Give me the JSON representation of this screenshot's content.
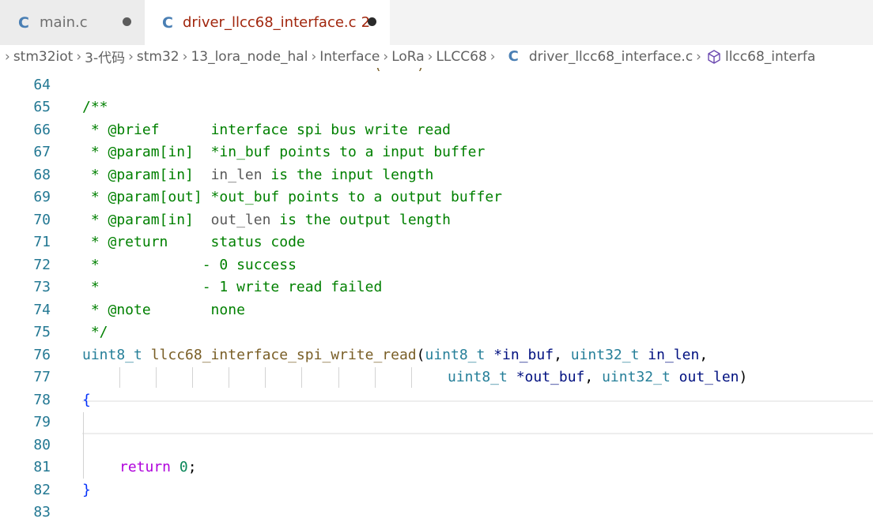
{
  "tabs": [
    {
      "icon": "C",
      "label": "main.c",
      "count": "",
      "modified": true,
      "active": false
    },
    {
      "icon": "C",
      "label": "driver_llcc68_interface.c",
      "count": "2",
      "modified": true,
      "active": true
    }
  ],
  "breadcrumb": {
    "items": [
      "stm32iot",
      "3-代码",
      "stm32",
      "13_lora_node_hal",
      "Interface",
      "LoRa",
      "LLCC68"
    ],
    "file_icon": "C",
    "file": "driver_llcc68_interface.c",
    "symbol_icon": "cube-icon",
    "symbol": "llcc68_interfa"
  },
  "editor": {
    "line_numbers": [
      "64",
      "65",
      "66",
      "67",
      "68",
      "69",
      "70",
      "71",
      "72",
      "73",
      "74",
      "75",
      "76",
      "77",
      "78",
      "79",
      "80",
      "81",
      "82",
      "83"
    ],
    "lines": {
      "l65": "/**",
      "l66_tag": " * @brief",
      "l66_text": "      interface spi bus write read",
      "l67_tag": " * @param[in]",
      "l67_text": "  *in_buf points to a input buffer",
      "l68_tag": " * @param[in]",
      "l68_param": "  in_len",
      "l68_text": " is the input length",
      "l69_tag": " * @param[out]",
      "l69_text": " *out_buf points to a output buffer",
      "l70_tag": " * @param[in]",
      "l70_param": "  out_len",
      "l70_text": " is the output length",
      "l71_tag": " * @return",
      "l71_text": "     status code",
      "l72_text": " *            - 0 success",
      "l73_text": " *            - 1 write read failed",
      "l74_tag": " * @note",
      "l74_text": "       none",
      "l75": " */",
      "l76_type1": "uint8_t",
      "l76_fn": "llcc68_interface_spi_write_read",
      "l76_open": "(",
      "l76_type2": "uint8_t",
      "l76_p1": " *in_buf",
      "l76_comma1": ",",
      "l76_type3": "uint32_t",
      "l76_p2": "in_len",
      "l76_comma2": ",",
      "l77_type1": "uint8_t",
      "l77_p1": " *out_buf",
      "l77_comma": ",",
      "l77_type2": "uint32_t",
      "l77_p2": "out_len",
      "l77_close": ")",
      "l78": "{",
      "l81_kw": "return",
      "l81_num": "0",
      "l81_semi": ";",
      "l82": "}"
    }
  },
  "colors": {
    "comment": "#008000",
    "keyword": "#0000ff",
    "type": "#267f99",
    "function": "#795e26",
    "parameter": "#001080",
    "number": "#098658",
    "control": "#af00db",
    "line_number": "#237893",
    "tab_active_text": "#a1260d",
    "c_icon": "#4a7fb4"
  }
}
